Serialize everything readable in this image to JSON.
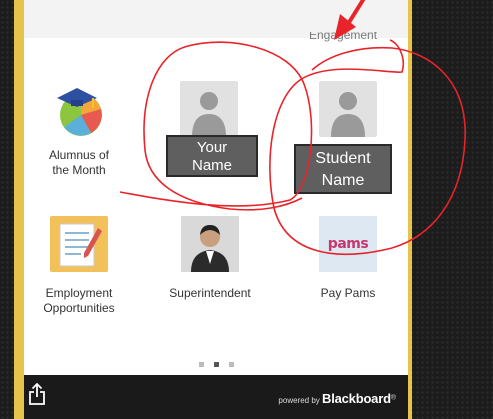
{
  "screen": {
    "top_label": "Engagement",
    "tiles": [
      {
        "label_line1": "Alumnus of",
        "label_line2": "the Month",
        "icon": "graduation-globe-icon"
      },
      {
        "label_line1": "",
        "label_line2": "",
        "icon": "person-placeholder-icon",
        "overlay_line1": "Your",
        "overlay_line2": "Name"
      },
      {
        "label_line1": "",
        "label_line2": "",
        "icon": "person-placeholder-icon",
        "overlay_line1": "Student",
        "overlay_line2": "Name"
      },
      {
        "label_line1": "Employment",
        "label_line2": "Opportunities",
        "icon": "document-pencil-icon"
      },
      {
        "label_line1": "Superintendent",
        "label_line2": "",
        "icon": "person-photo-icon"
      },
      {
        "label_line1": "Pay Pams",
        "label_line2": "",
        "icon": "pams-logo-icon",
        "logo_text": "pams"
      }
    ],
    "pagination": {
      "count": 3,
      "active_index": 1
    }
  },
  "footer": {
    "powered_prefix": "powered by",
    "brand": "Blackboard",
    "trademark": "®",
    "share_icon": "share-icon"
  },
  "annotation_colors": {
    "circle": "#e8242a",
    "arrow": "#e8242a"
  }
}
